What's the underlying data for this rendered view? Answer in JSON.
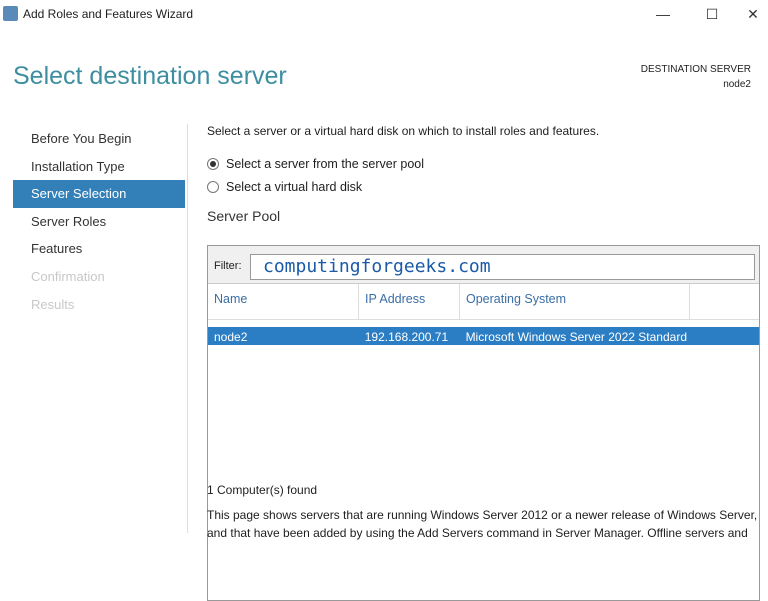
{
  "window": {
    "title": "Add Roles and Features Wizard",
    "minimize": "—",
    "maximize": "☐",
    "close": "✕"
  },
  "header": {
    "title": "Select destination server",
    "dest_label": "DESTINATION SERVER",
    "dest_value": "node2"
  },
  "nav": [
    {
      "label": "Before You Begin"
    },
    {
      "label": "Installation Type"
    },
    {
      "label": "Server Selection"
    },
    {
      "label": "Server Roles"
    },
    {
      "label": "Features"
    },
    {
      "label": "Confirmation"
    },
    {
      "label": "Results"
    }
  ],
  "main": {
    "instruction": "Select a server or a virtual hard disk on which to install roles and features.",
    "radio1": "Select a server from the server pool",
    "radio2": "Select a virtual hard disk",
    "pool_title": "Server Pool",
    "filter_label": "Filter:",
    "filter_value": "computingforgeeks.com",
    "columns": [
      "Name",
      "IP Address",
      "Operating System"
    ],
    "rows": [
      {
        "name": "node2",
        "ip": "192.168.200.71",
        "os": "Microsoft Windows Server 2022 Standard"
      }
    ],
    "found": "1 Computer(s) found",
    "desc": "This page shows servers that are running Windows Server 2012 or a newer release of Windows Server, and that have been added by using the Add Servers command in Server Manager. Offline servers and"
  }
}
